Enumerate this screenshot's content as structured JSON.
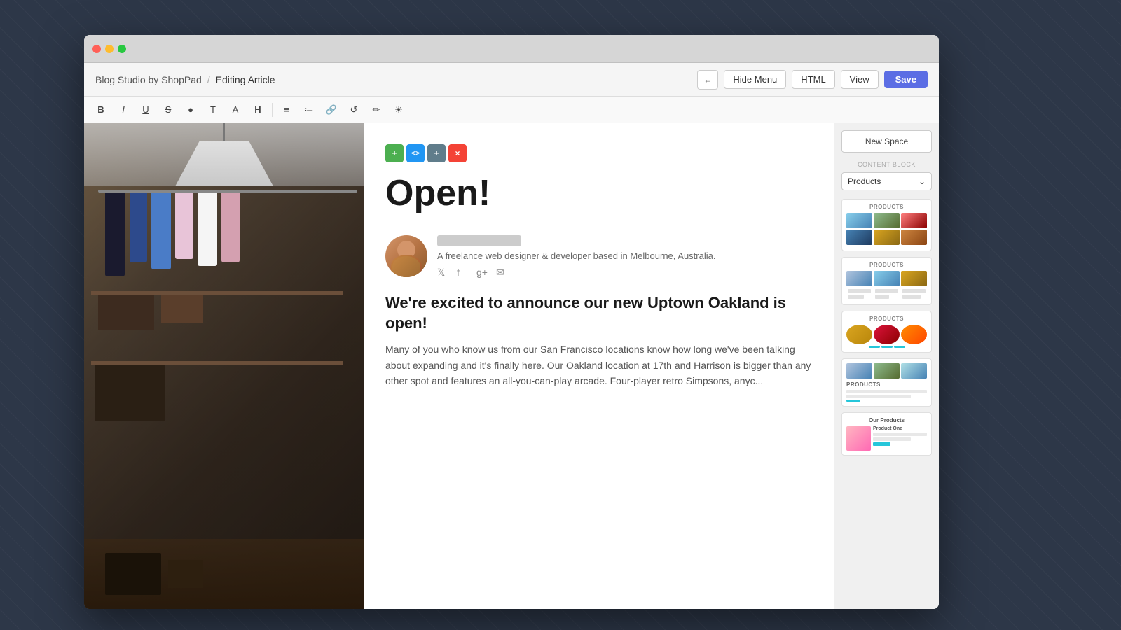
{
  "app": {
    "title": "Blog Studio by ShopPad",
    "separator": "/",
    "current_page": "Editing Article"
  },
  "toolbar": {
    "back_label": "←",
    "hide_menu_label": "Hide Menu",
    "html_label": "HTML",
    "view_label": "View",
    "save_label": "Save"
  },
  "editor_toolbar": {
    "buttons": [
      "B",
      "I",
      "U",
      "S",
      "●",
      "T̶",
      "A",
      "H",
      "≡",
      "≔",
      "🔗",
      "↺",
      "✏",
      "☀"
    ]
  },
  "article": {
    "title": "Open!",
    "author_bio": "A freelance web designer & developer based in Melbourne, Australia.",
    "body_text": "Many of you who know us from our San Francisco locations know how long we've been talking about expanding and it's finally here. Our Oakland location at 17th and Harrison is bigger than any other spot and features an all-you-can-play arcade. Four-player retro Simpsons, anyc...",
    "heading": "We're excited to announce our new Uptown Oakland is open!"
  },
  "sidebar": {
    "new_space_label": "New Space",
    "content_block_label": "CONTENT BLOCK",
    "products_select": "Products",
    "products_select_arrow": "⌄",
    "templates": [
      {
        "id": "tmpl1",
        "title": "PRODUCTS"
      },
      {
        "id": "tmpl2",
        "title": "Products"
      },
      {
        "id": "tmpl3",
        "title": "Products"
      },
      {
        "id": "tmpl4",
        "title": "PRODUCTS"
      },
      {
        "id": "tmpl5",
        "title": "Our Products"
      }
    ]
  },
  "block_controls": {
    "add_label": "+",
    "code_label": "<>",
    "move_label": "+",
    "delete_label": "×"
  }
}
